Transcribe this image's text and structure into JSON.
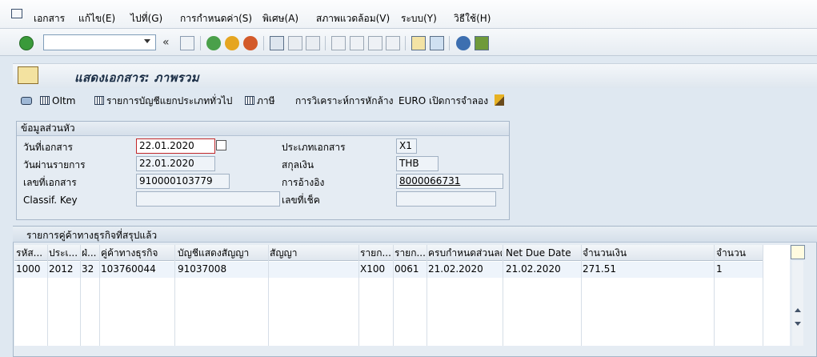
{
  "menu": [
    "เอกสาร",
    "แก้ไข(E)",
    "ไปที่(G)",
    "การกำหนดค่า(S)",
    "พิเศษ(A)",
    "สภาพแวดล้อม(V)",
    "ระบบ(Y)",
    "วิธีใช้(H)"
  ],
  "page_title": "แสดงเอกสาร: ภาพรวม",
  "app_toolbar": {
    "oitm": "OItm",
    "gl": "รายการบัญชีแยกประเภททั่วไป",
    "tax": "ภาษี",
    "clearing": "การวิเคราะห์การหักล้าง",
    "euro": "EURO เปิดการจำลอง"
  },
  "header": {
    "title": "ข้อมูลส่วนหัว",
    "doc_date_label": "วันที่เอกสาร",
    "doc_date": "22.01.2020",
    "posting_date_label": "วันผ่านรายการ",
    "posting_date": "22.01.2020",
    "doc_no_label": "เลขที่เอกสาร",
    "doc_no": "910000103779",
    "classif_label": "Classif. Key",
    "classif": "",
    "doc_type_label": "ประเภทเอกสาร",
    "doc_type": "X1",
    "currency_label": "สกุลเงิน",
    "currency": "THB",
    "reference_label": "การอ้างอิง",
    "reference": "8000066731",
    "cheque_label": "เลขที่เช็ค",
    "cheque": ""
  },
  "list": {
    "title": "รายการคู่ค้าทางธุรกิจที่สรุปแล้ว",
    "columns": [
      "รหัส...",
      "ประเ...",
      "ฝ่...",
      "คู่ค้าทางธุรกิจ",
      "บัญชีแสดงสัญญา",
      "สัญญา",
      "รายก...",
      "รายก...",
      "ครบกำหนดส่วนลด",
      "Net Due Date",
      "จำนวนเงิน",
      "จำนวน"
    ],
    "rows": [
      [
        "1000",
        "2012",
        "32",
        "103760044",
        "91037008",
        "",
        "X100",
        "0061",
        "21.02.2020",
        "21.02.2020",
        "271.51",
        "1"
      ]
    ]
  },
  "colors": {
    "accent_red": "#c2282a",
    "panel_bg": "#e5ecf3",
    "selected_row": "#eef4fb"
  }
}
